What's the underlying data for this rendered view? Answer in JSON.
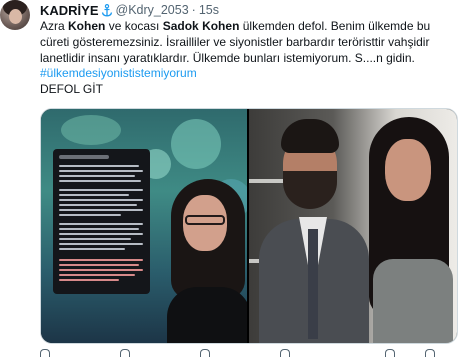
{
  "tweet": {
    "display_name": "KADRİYE",
    "handle": "@Kdry_2053",
    "separator": "·",
    "time": "15s",
    "verified_icon": "anchor-icon",
    "text": {
      "l1_a": "Azra ",
      "l1_b": "Kohen",
      "l1_c": " ve kocası ",
      "l1_d": "Sadok Kohen",
      "l1_e": " ülkemden defol.  Benim ülkemde bu",
      "l2": "cüreti gösteremezsiniz. İsrailliler ve siyonistler barbardır teröristtir vahşidir",
      "l3": "lanetlidir insanı yaratıklardır. Ülkemde bunları istemiyorum.  S....n gidin.",
      "hashtag": "#ülkemdesiyonististemiyorum",
      "l5": "DEFOL GİT"
    },
    "media": {
      "left_image": "tv-screenshot-woman-with-document",
      "right_image": "couple-photo"
    },
    "actions": [
      "reply-icon",
      "retweet-icon",
      "like-icon",
      "views-icon",
      "bookmark-icon",
      "share-icon"
    ]
  },
  "colors": {
    "text": "#0f1419",
    "secondary": "#536471",
    "link": "#1d9bf0",
    "border": "#cfd9de"
  }
}
